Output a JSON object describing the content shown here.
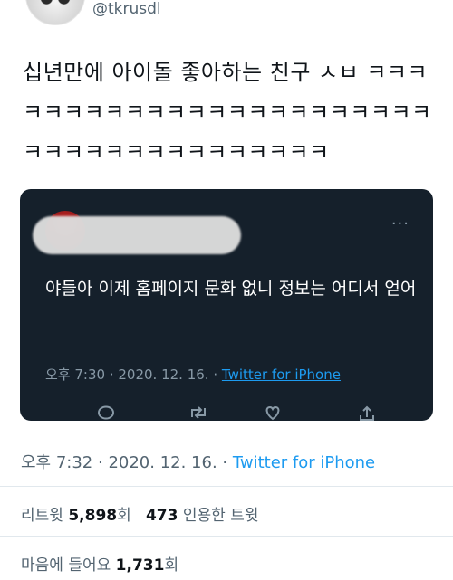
{
  "user": {
    "handle": "@tkrusdl"
  },
  "tweet": {
    "text": "십년만에 아이돌 좋아하는 친구 ㅅㅂ ㅋㅋㅋㅋㅋㅋㅋㅋㅋㅋㅋㅋㅋㅋㅋㅋㅋㅋㅋㅋㅋㅋㅋㅋㅋㅋㅋㅋㅋㅋㅋㅋㅋㅋㅋㅋㅋㅋ",
    "time": "오후 7:32",
    "date": "2020. 12. 16.",
    "source": "Twitter for iPhone"
  },
  "quote": {
    "text": "야들아 이제 홈페이지 문화 없니 정보는 어디서 얻어",
    "time": "오후 7:30",
    "date": "2020. 12. 16.",
    "source": "Twitter for iPhone",
    "more_icon": "more-dots-icon"
  },
  "stats": {
    "retweets_label": "리트윗",
    "retweets_count": "5,898",
    "retweets_unit": "회",
    "quotes_count": "473",
    "quotes_label": "인용한 트윗",
    "likes_label": "마음에 들어요",
    "likes_count": "1,731",
    "likes_unit": "회"
  },
  "colors": {
    "accent": "#1d9bf0",
    "quote_bg": "#15202b"
  }
}
